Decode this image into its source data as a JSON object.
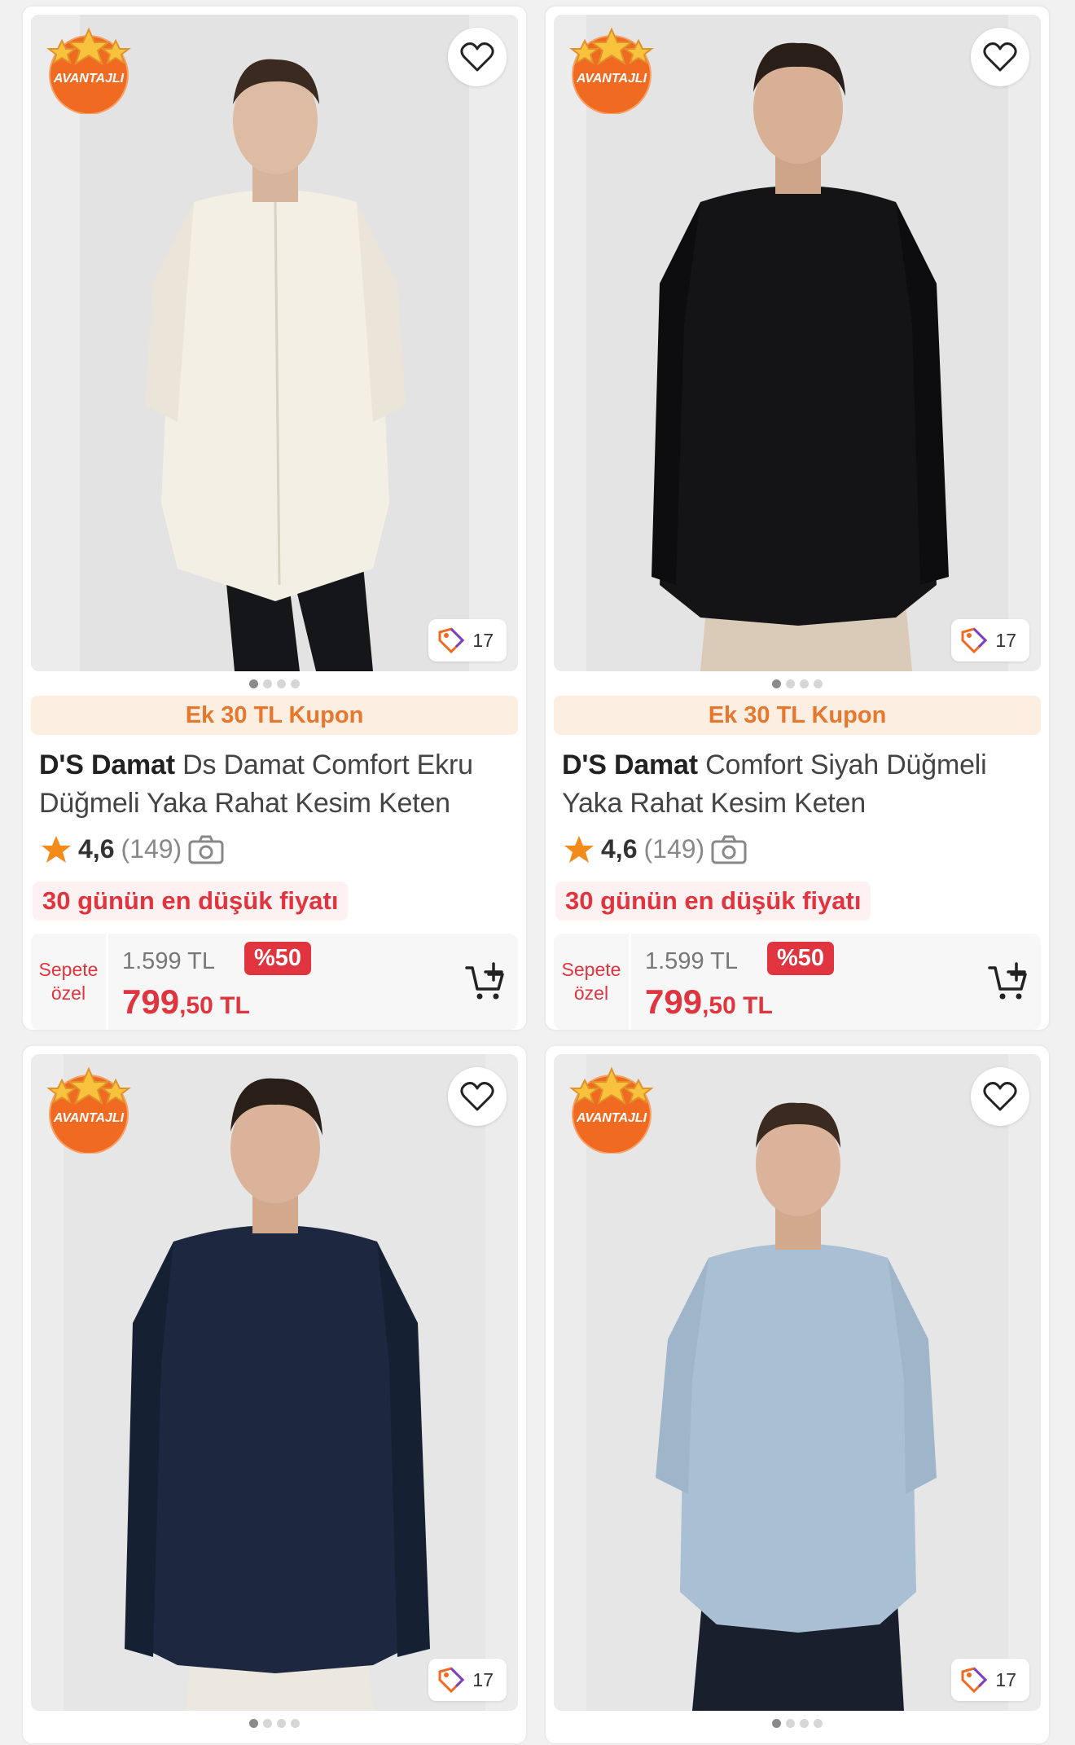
{
  "products": [
    {
      "badge": "AVANTAJLI",
      "image_count": "17",
      "coupon": "Ek 30 TL Kupon",
      "brand": "D'S Damat",
      "name": "Ds Damat Comfort Ekru Düğmeli Yaka Rahat Kesim Keten",
      "rating": "4,6",
      "rating_count": "(149)",
      "lowest_label": "30 günün en düşük fiyatı",
      "sepete_line1": "Sepete",
      "sepete_line2": "özel",
      "old_price": "1.599 TL",
      "discount": "%50",
      "price_main": "799",
      "price_rest": ",50 TL",
      "shirt_color": "#f3efe4",
      "pants_color": "#15161a"
    },
    {
      "badge": "AVANTAJLI",
      "image_count": "17",
      "coupon": "Ek 30 TL Kupon",
      "brand": "D'S Damat",
      "name": "Comfort Siyah Düğmeli Yaka Rahat Kesim Keten",
      "rating": "4,6",
      "rating_count": "(149)",
      "lowest_label": "30 günün en düşük fiyatı",
      "sepete_line1": "Sepete",
      "sepete_line2": "özel",
      "old_price": "1.599 TL",
      "discount": "%50",
      "price_main": "799",
      "price_rest": ",50 TL",
      "shirt_color": "#141416",
      "pants_color": "#d9cbb7"
    },
    {
      "badge": "AVANTAJLI",
      "image_count": "17",
      "shirt_color": "#1d2740",
      "pants_color": "#ece8df"
    },
    {
      "badge": "AVANTAJLI",
      "image_count": "17",
      "shirt_color": "#a9bfd3",
      "pants_color": "#1a1f2e"
    }
  ]
}
